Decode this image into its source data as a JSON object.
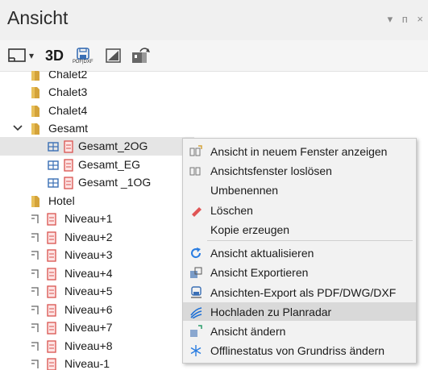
{
  "panel": {
    "title": "Ansicht",
    "controls": [
      "▾",
      "ᴨ",
      "×"
    ]
  },
  "toolbar": {
    "btn_3d": "3D",
    "pdf_label": "PDF|DXF"
  },
  "tree": {
    "items": [
      {
        "label": "Chalet2"
      },
      {
        "label": "Chalet3"
      },
      {
        "label": "Chalet4"
      },
      {
        "label": "Gesamt"
      },
      {
        "label": "Gesamt_2OG"
      },
      {
        "label": "Gesamt_EG"
      },
      {
        "label": "Gesamt _1OG"
      },
      {
        "label": "Hotel"
      },
      {
        "label": "Niveau+1"
      },
      {
        "label": "Niveau+2"
      },
      {
        "label": "Niveau+3"
      },
      {
        "label": "Niveau+4"
      },
      {
        "label": "Niveau+5"
      },
      {
        "label": "Niveau+6"
      },
      {
        "label": "Niveau+7"
      },
      {
        "label": "Niveau+8"
      },
      {
        "label": "Niveau-1"
      }
    ]
  },
  "context_menu": {
    "items": [
      {
        "label": "Ansicht in neuem Fenster anzeigen"
      },
      {
        "label": "Ansichtsfenster loslösen"
      },
      {
        "label": "Umbenennen"
      },
      {
        "label": "Löschen"
      },
      {
        "label": "Kopie erzeugen"
      },
      {
        "label": "Ansicht aktualisieren"
      },
      {
        "label": "Ansicht Exportieren"
      },
      {
        "label": "Ansichten-Export als PDF/DWG/DXF"
      },
      {
        "label": "Hochladen zu Planradar"
      },
      {
        "label": "Ansicht ändern"
      },
      {
        "label": "Offlinestatus von Grundriss ändern"
      }
    ]
  },
  "colors": {
    "folder": "#d4a33a",
    "doc": "#d9534f",
    "view_blue": "#3a6fb5",
    "accent": "#2a7de1"
  }
}
